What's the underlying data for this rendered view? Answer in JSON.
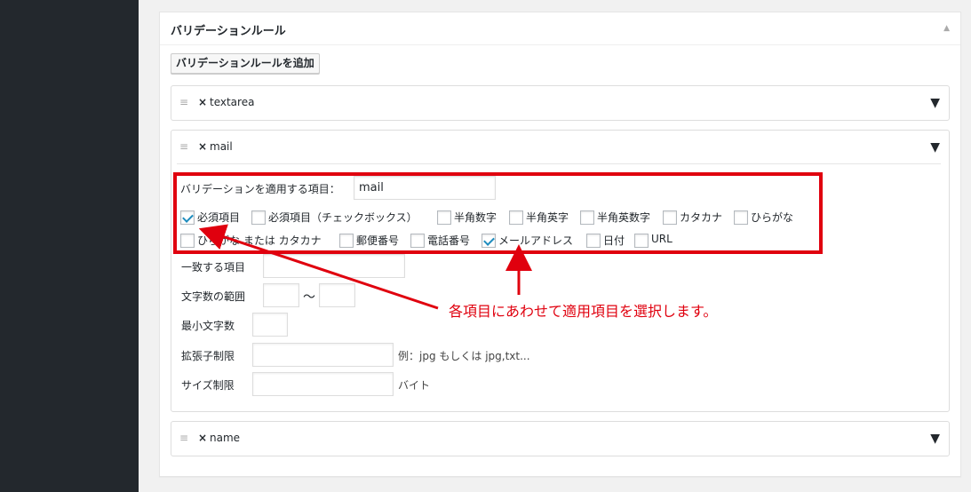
{
  "box": {
    "title": "バリデーションルール",
    "toggle": "▲"
  },
  "add_button": "バリデーションルールを追加",
  "rules": [
    {
      "handle": "≡",
      "remove": "×",
      "name": "textarea",
      "toggle": "▼"
    },
    {
      "handle": "≡",
      "remove": "×",
      "name": "mail",
      "toggle": "▼"
    },
    {
      "handle": "≡",
      "remove": "×",
      "name": "name",
      "toggle": "▼"
    }
  ],
  "mail_rule": {
    "target_label": "バリデーションを適用する項目：",
    "target_value": "mail",
    "checks": [
      {
        "label": "必須項目",
        "checked": true
      },
      {
        "label": "必須項目（チェックボックス）",
        "checked": false
      },
      {
        "label": "半角数字",
        "checked": false
      },
      {
        "label": "半角英字",
        "checked": false
      },
      {
        "label": "半角英数字",
        "checked": false
      },
      {
        "label": "カタカナ",
        "checked": false
      },
      {
        "label": "ひらがな",
        "checked": false
      },
      {
        "label": "ひらがな または カタカナ",
        "checked": false
      },
      {
        "label": "郵便番号",
        "checked": false
      },
      {
        "label": "電話番号",
        "checked": false
      },
      {
        "label": "メールアドレス",
        "checked": true
      },
      {
        "label": "日付",
        "checked": false
      },
      {
        "label": "URL",
        "checked": false
      }
    ],
    "match_label": "一致する項目",
    "range_label": "文字数の範囲",
    "range_sep": "〜",
    "min_label": "最小文字数",
    "ext_label": "拡張子制限",
    "ext_hint": "例：jpg もしくは jpg,txt...",
    "size_label": "サイズ制限",
    "size_unit": "バイト"
  },
  "annotation": {
    "text": "各項目にあわせて適用項目を選択します。",
    "color": "#e0000e"
  }
}
